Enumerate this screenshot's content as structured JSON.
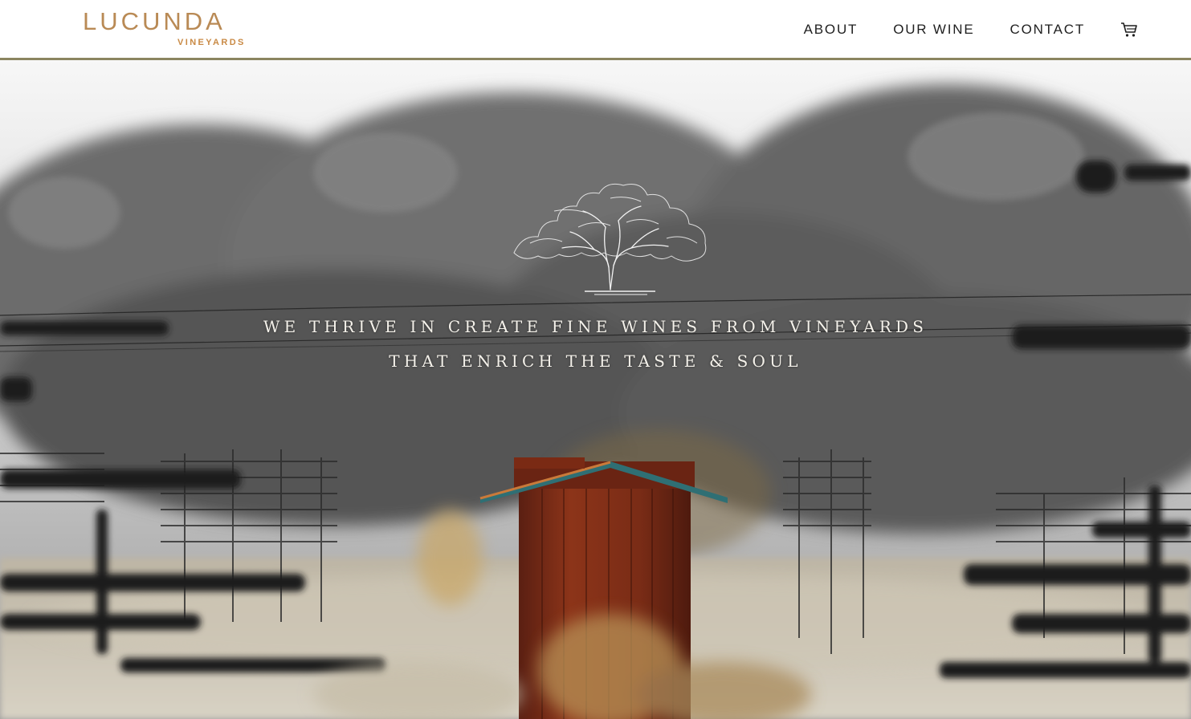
{
  "brand": {
    "name": "LUCUNDA",
    "sub": "VINEYARDS",
    "accent_color": "#b98a55"
  },
  "nav": {
    "items": [
      {
        "label": "ABOUT"
      },
      {
        "label": "OUR WINE"
      },
      {
        "label": "CONTACT"
      }
    ],
    "cart_icon": "shopping-cart-icon"
  },
  "hero": {
    "line1": "WE THRIVE IN CREATE FINE WINES FROM VINEYARDS",
    "line2": "THAT ENRICH THE TASTE & SOUL",
    "emblem_icon": "oak-tree-emblem",
    "photo_subject": "red wooden shed in vineyard"
  }
}
